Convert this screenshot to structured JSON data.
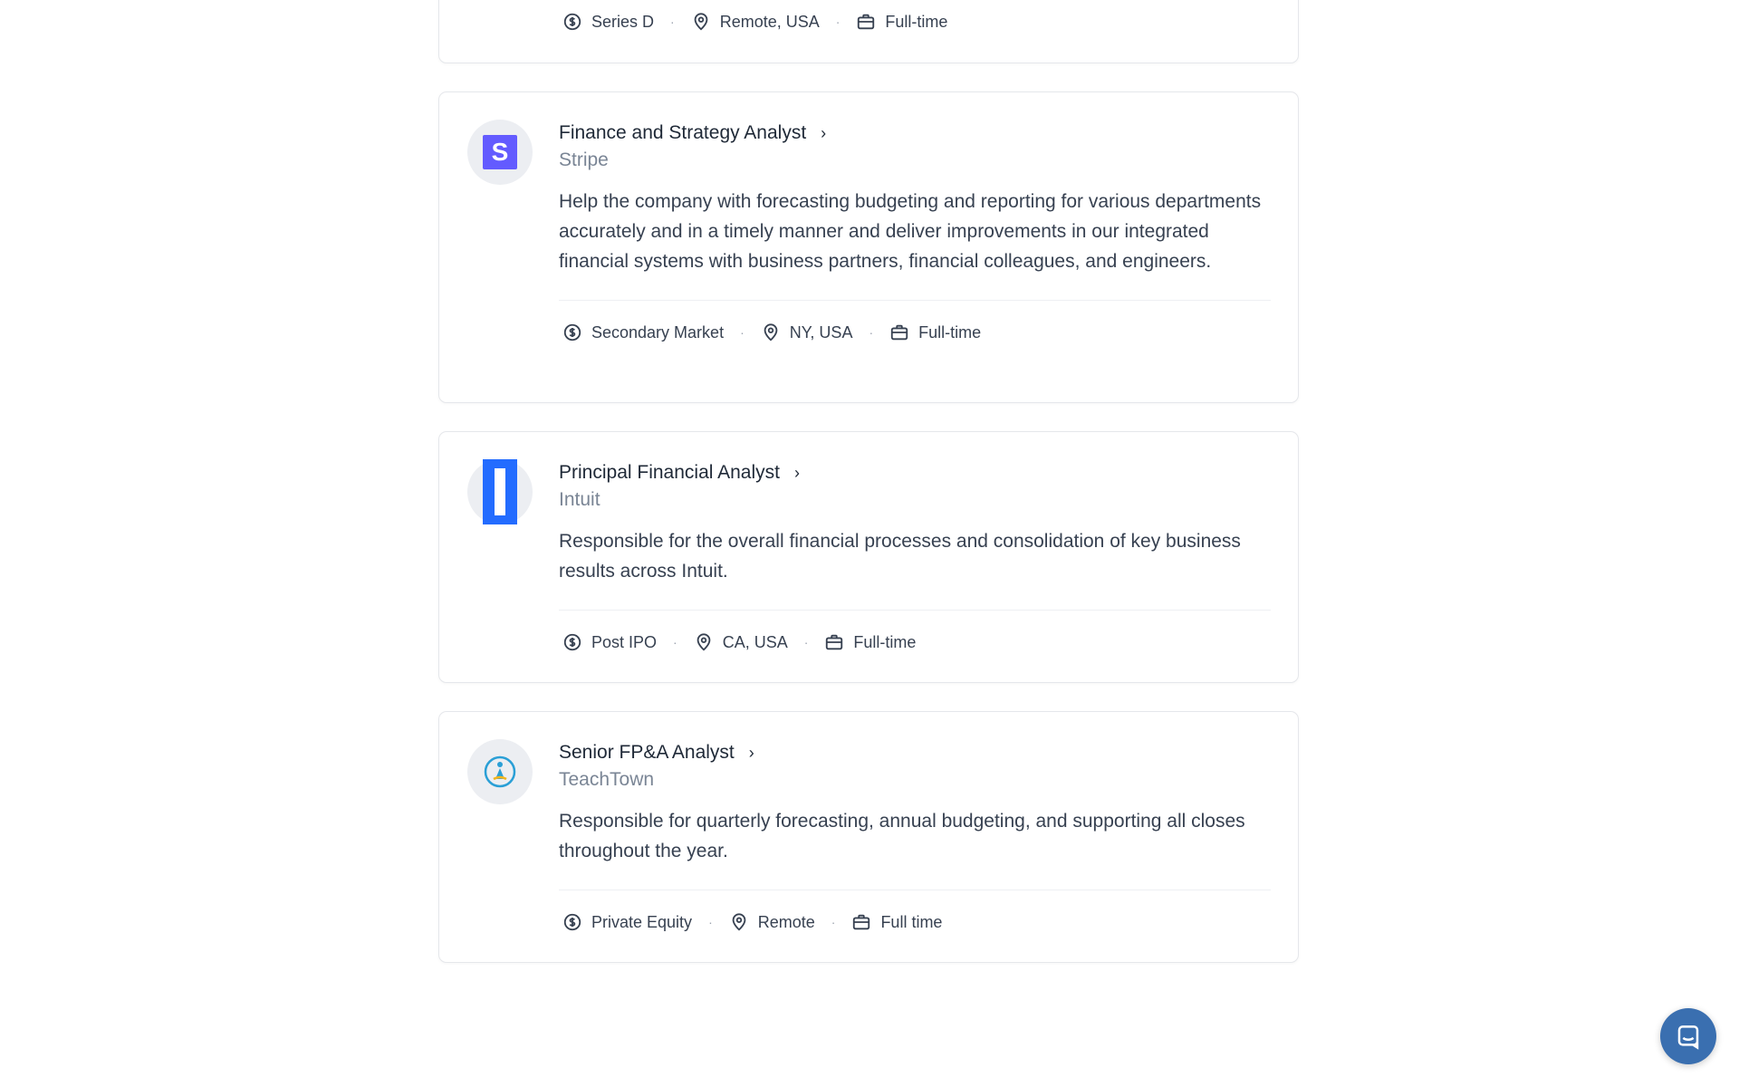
{
  "jobs": [
    {
      "title": "",
      "company": "",
      "description": "",
      "stage": "Series D",
      "location": "Remote, USA",
      "type": "Full-time"
    },
    {
      "title": "Finance and Strategy Analyst",
      "company": "Stripe",
      "logo_text": "S",
      "description": "Help the company with forecasting budgeting and reporting for various departments accurately and in a timely manner and deliver improvements in our integrated financial systems with business partners, financial colleagues, and engineers.",
      "stage": "Secondary Market",
      "location": "NY, USA",
      "type": "Full-time"
    },
    {
      "title": "Principal Financial Analyst",
      "company": "Intuit",
      "logo_text": "I",
      "description": "Responsible for the overall financial processes and consolidation of key business results across Intuit.",
      "stage": "Post IPO",
      "location": "CA, USA",
      "type": "Full-time"
    },
    {
      "title": "Senior FP&A Analyst",
      "company": "TeachTown",
      "description": "Responsible for quarterly forecasting, annual budgeting, and supporting all closes throughout the year.",
      "stage": "Private Equity",
      "location": "Remote",
      "type": "Full time"
    }
  ],
  "icons": {
    "chevron": "chevron-right-icon",
    "stage": "dollar-circle-icon",
    "location": "map-pin-icon",
    "type": "briefcase-icon",
    "chat": "chat-icon"
  },
  "colors": {
    "stripe": "#635bff",
    "intuit": "#236cff",
    "teachtown": "#2a9fd6",
    "chat": "#3a6fb0"
  }
}
